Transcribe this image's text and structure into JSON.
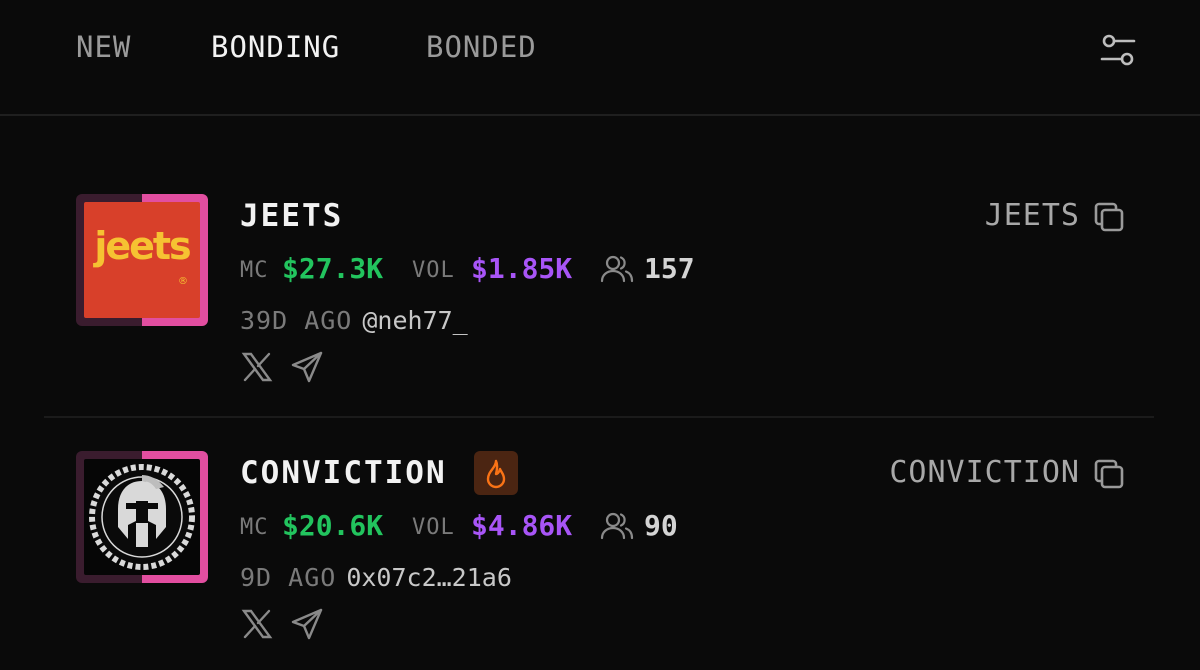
{
  "tabs": [
    {
      "label": "NEW"
    },
    {
      "label": "BONDING"
    },
    {
      "label": "BONDED"
    }
  ],
  "icons": {
    "filter": "sliders-icon",
    "holders": "users-icon",
    "twitter": "x-icon",
    "telegram": "telegram-icon",
    "copy": "copy-icon",
    "hot": "fire-icon"
  },
  "colors": {
    "mc": "#22c45e",
    "vol": "#a855f7",
    "accent_pink": "#e24ea0"
  },
  "tokens": [
    {
      "name": "JEETS",
      "ticker": "JEETS",
      "logo_text": "jeets",
      "logo_mark": "®",
      "mc_label": "MC",
      "mc_value": "$27.3K",
      "vol_label": "VOL",
      "vol_value": "$1.85K",
      "holders": "157",
      "age": "39D AGO",
      "creator": "@neh77_",
      "hot": false
    },
    {
      "name": "CONVICTION",
      "ticker": "CONVICTION",
      "mc_label": "MC",
      "mc_value": "$20.6K",
      "vol_label": "VOL",
      "vol_value": "$4.86K",
      "holders": "90",
      "age": "9D AGO",
      "creator": "0x07c2…21a6",
      "hot": true
    }
  ]
}
